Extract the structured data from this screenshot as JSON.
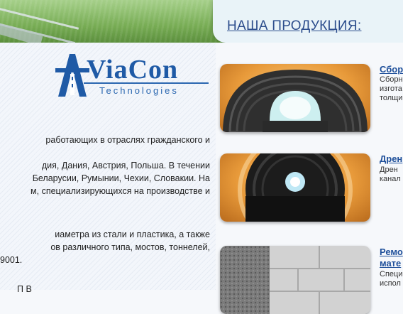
{
  "header": {
    "products_title": "НАША ПРОДУКЦИЯ:"
  },
  "logo": {
    "name": "ViaCon",
    "subtitle": "Technologies"
  },
  "intro": {
    "p1": [
      "работающих в отраслях гражданского и"
    ],
    "p2": [
      "дия, Дания, Австрия, Польша. В течении",
      "Беларусии, Румынии, Чехии, Словакии. На",
      "м, специализирующихся на производстве и"
    ],
    "p3": [
      "иаметра из стали и пластика, а также",
      "ов различного типа, мостов, тоннелей,",
      "9001."
    ],
    "p4": [
      "П         В"
    ]
  },
  "products": [
    {
      "title": "Сбор",
      "desc": [
        "Сборн",
        "изгота",
        "толщи"
      ],
      "image": "steel-arch-culvert-image"
    },
    {
      "title": "Дрен",
      "desc": [
        "Дрен",
        "канал"
      ],
      "image": "drainage-pipe-image"
    },
    {
      "title": "Ремо",
      "title2": "мате",
      "desc": [
        "Специ",
        "испол"
      ],
      "image": "stone-wall-repair-image"
    }
  ],
  "colors": {
    "link_blue": "#1e4f9a",
    "logo_blue": "#1f5aa6",
    "thumb_orange": "#e89a3a"
  }
}
